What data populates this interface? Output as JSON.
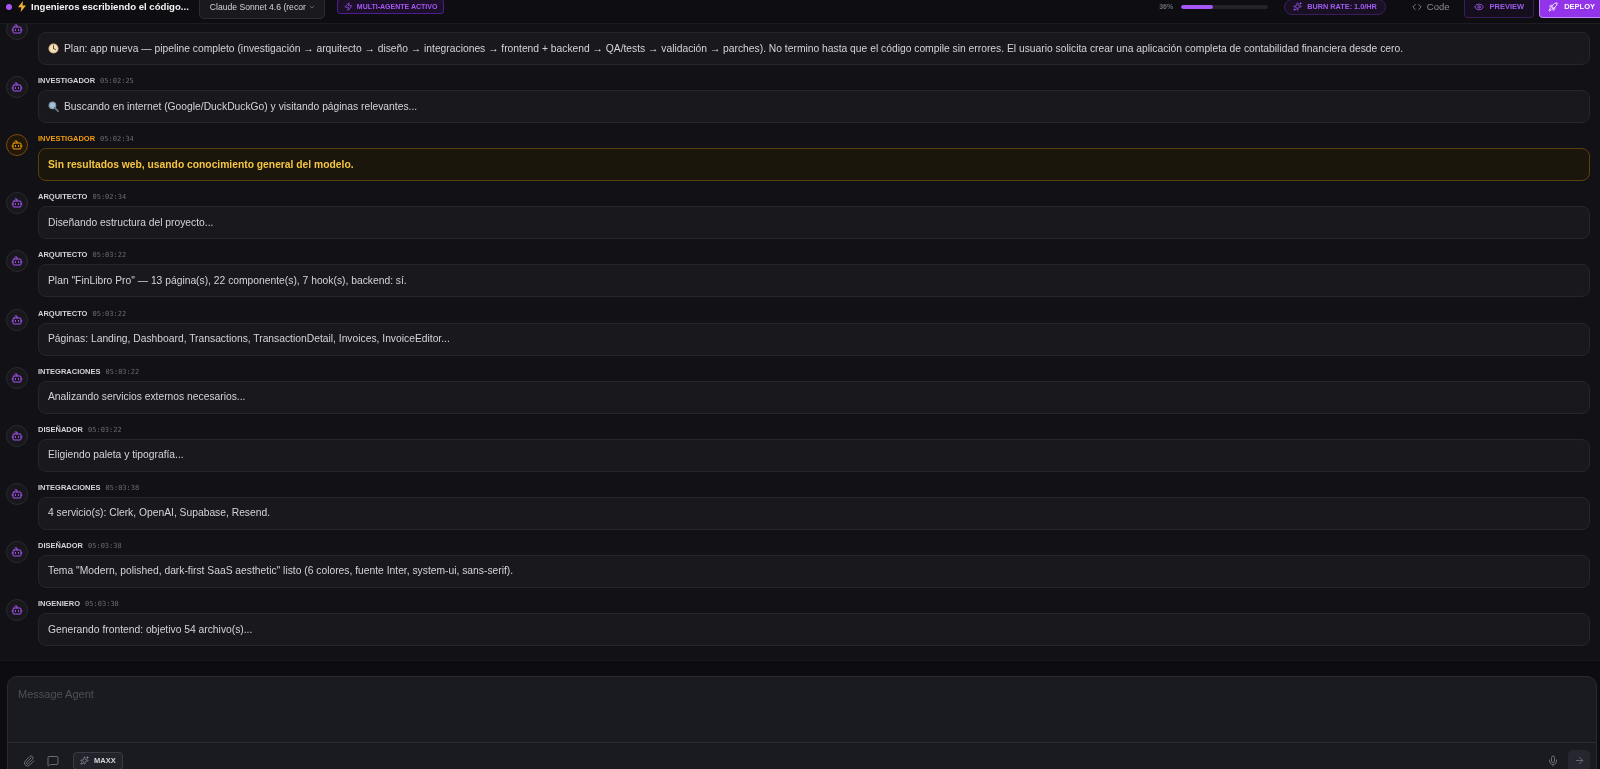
{
  "header": {
    "running": true,
    "title": "Ingenieros escribiendo el código...",
    "model": "Claude Sonnet 4.6 (recor",
    "mode_badge": "MULTI-AGENTE ACTIVO"
  },
  "toolbar": {
    "progress": {
      "reading": "36%",
      "level": 0.36
    },
    "burn_rate": "BURN RATE: 1.0/HR",
    "code_tab": "Code",
    "preview_button": "PREVIEW",
    "deploy_button": "DEPLOY"
  },
  "messages": [
    {
      "kind": "plan",
      "text": "Plan: app nueva — pipeline completo (investigación → arquitecto → diseño → integraciones → frontend + backend → QA/tests → validación → parches). No termino hasta que el código compile sin errores. El usuario solicita crear una aplicación completa de contabilidad financiera desde cero."
    },
    {
      "role": "INVESTIGADOR",
      "time": "05:02:25",
      "kind": "search",
      "text": "Buscando en internet (Google/DuckDuckGo) y visitando páginas relevantes..."
    },
    {
      "role": "INVESTIGADOR",
      "time": "05:02:34",
      "kind": "warning",
      "text": "Sin resultados web, usando conocimiento general del modelo."
    },
    {
      "role": "ARQUITECTO",
      "time": "05:02:34",
      "kind": "status",
      "text": "Diseñando estructura del proyecto..."
    },
    {
      "role": "ARQUITECTO",
      "time": "05:03:22",
      "kind": "status",
      "text": "Plan \"FinLibro Pro\" — 13 página(s), 22 componente(s), 7 hook(s), backend: sí."
    },
    {
      "role": "ARQUITECTO",
      "time": "05:03:22",
      "kind": "status",
      "text": "Páginas: Landing, Dashboard, Transactions, TransactionDetail, Invoices, InvoiceEditor..."
    },
    {
      "role": "INTEGRACIONES",
      "time": "05:03:22",
      "kind": "status",
      "text": "Analizando servicios externos necesarios..."
    },
    {
      "role": "DISEÑADOR",
      "time": "05:03:22",
      "kind": "status",
      "text": "Eligiendo paleta y tipografía..."
    },
    {
      "role": "INTEGRACIONES",
      "time": "05:03:38",
      "kind": "status",
      "text": "4 servicio(s): Clerk, OpenAI, Supabase, Resend."
    },
    {
      "role": "DISEÑADOR",
      "time": "05:03:38",
      "kind": "status",
      "text": "Tema \"Modern, polished, dark-first SaaS aesthetic\" listo (6 colores, fuente Inter, system-ui, sans-serif)."
    },
    {
      "role": "INGENIERO",
      "time": "05:03:38",
      "kind": "status",
      "text": "Generando frontend: objetivo 54 archivo(s)..."
    }
  ],
  "composer": {
    "placeholder": "Message Agent",
    "mode_button": "MAXX"
  }
}
